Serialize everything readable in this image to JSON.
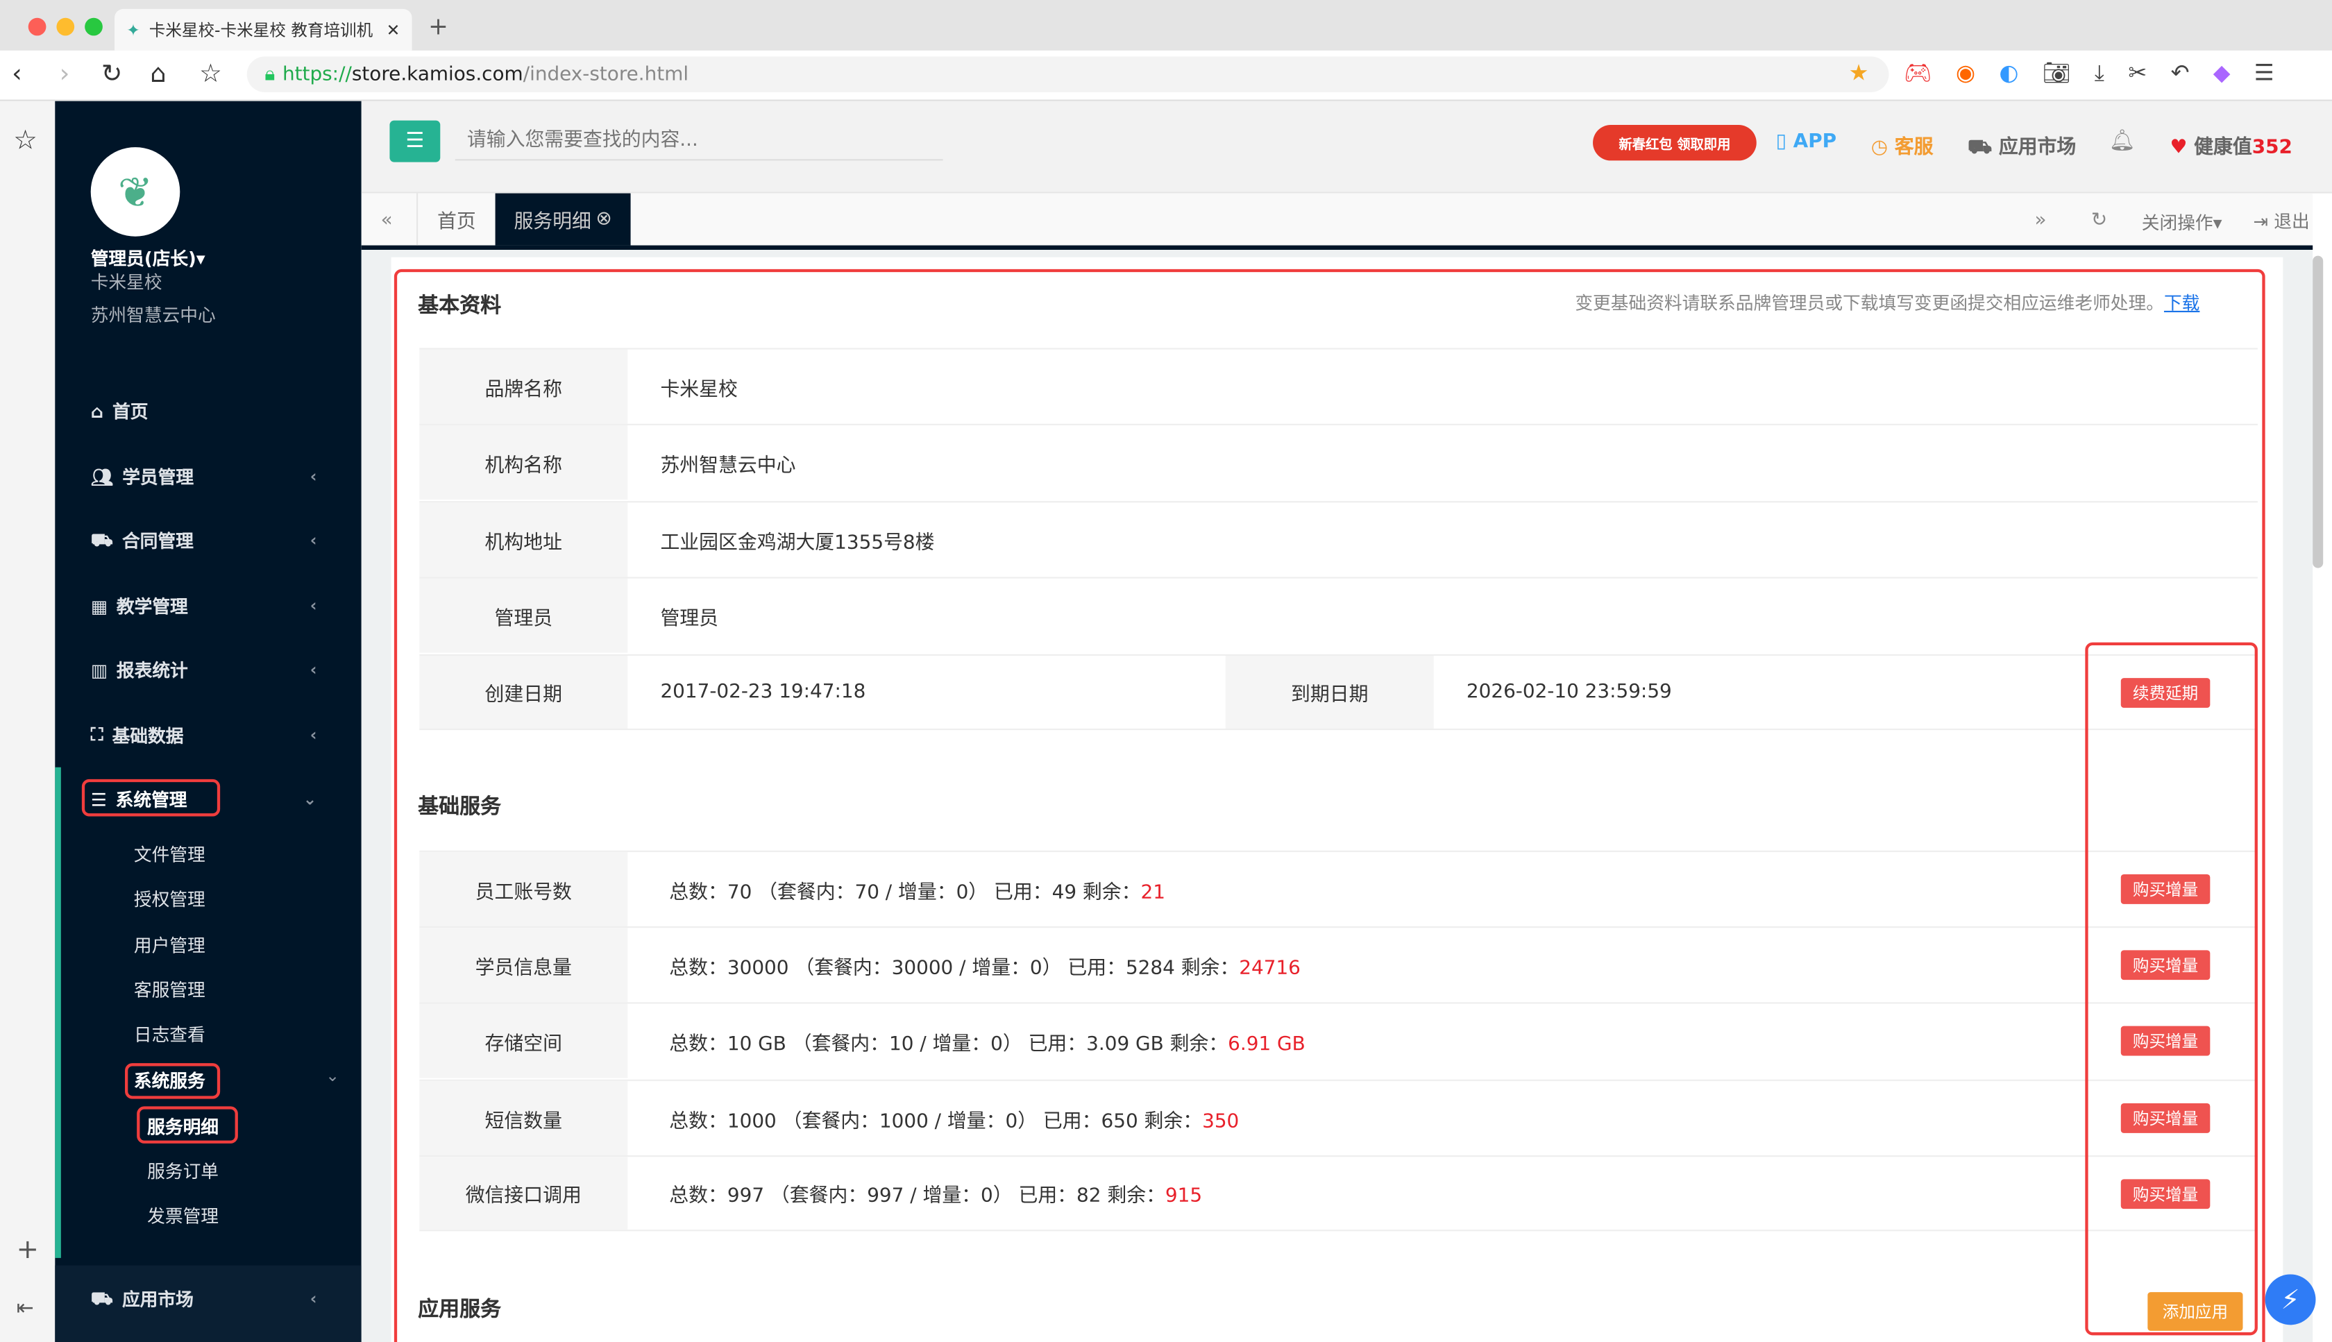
{
  "browser": {
    "tab_title": "卡米星校-卡米星校 教育培训机",
    "url_scheme": "https://",
    "url_host": "store.kamios.com",
    "url_path": "/index-store.html"
  },
  "user": {
    "name": "管理员(店长)▾",
    "brand": "卡米星校",
    "org": "苏州智慧云中心"
  },
  "sidebar": {
    "items": [
      {
        "label": "首页",
        "icon": "home-icon"
      },
      {
        "label": "学员管理",
        "icon": "users-icon"
      },
      {
        "label": "合同管理",
        "icon": "cart-icon"
      },
      {
        "label": "教学管理",
        "icon": "calendar-icon"
      },
      {
        "label": "报表统计",
        "icon": "bar-chart-icon"
      },
      {
        "label": "基础数据",
        "icon": "sitemap-icon"
      },
      {
        "label": "系统管理",
        "icon": "server-icon"
      }
    ],
    "sub": [
      "文件管理",
      "授权管理",
      "用户管理",
      "客服管理",
      "日志查看",
      "系统服务"
    ],
    "subsub": [
      "服务明细",
      "服务订单",
      "发票管理"
    ],
    "bottom": "应用市场"
  },
  "header": {
    "search_placeholder": "请输入您需要查找的内容...",
    "promo": "新春红包 领取即用",
    "app": "APP",
    "service": "客服",
    "market": "应用市场",
    "health_label": "健康值",
    "health_value": "352"
  },
  "tabs": {
    "home": "首页",
    "active": "服务明细",
    "close_ops": "关闭操作▾",
    "logout": "退出"
  },
  "basic": {
    "title": "基本资料",
    "notice": "变更基础资料请联系品牌管理员或下载填写变更函提交相应运维老师处理。",
    "download": "下载",
    "rows": [
      {
        "label": "品牌名称",
        "value": "卡米星校"
      },
      {
        "label": "机构名称",
        "value": "苏州智慧云中心"
      },
      {
        "label": "机构地址",
        "value": "工业园区金鸡湖大厦1355号8楼"
      },
      {
        "label": "管理员",
        "value": "管理员"
      }
    ],
    "created_label": "创建日期",
    "created": "2017-02-23 19:47:18",
    "expire_label": "到期日期",
    "expire": "2026-02-10 23:59:59",
    "renew": "续费延期"
  },
  "services": {
    "title": "基础服务",
    "buy": "购买增量",
    "rows": [
      {
        "label": "员工账号数",
        "text": "总数：70 （套餐内：70 / 增量：0） 已用：49 剩余：",
        "remain": "21"
      },
      {
        "label": "学员信息量",
        "text": "总数：30000 （套餐内：30000 / 增量：0） 已用：5284 剩余：",
        "remain": "24716"
      },
      {
        "label": "存储空间",
        "text": "总数：10 GB （套餐内：10 / 增量：0） 已用：3.09 GB 剩余：",
        "remain": "6.91 GB"
      },
      {
        "label": "短信数量",
        "text": "总数：1000 （套餐内：1000 / 增量：0） 已用：650 剩余：",
        "remain": "350"
      },
      {
        "label": "微信接口调用",
        "text": "总数：997 （套餐内：997 / 增量：0） 已用：82 剩余：",
        "remain": "915"
      }
    ]
  },
  "apps": {
    "title": "应用服务",
    "add": "添加应用"
  },
  "colors": {
    "sidebar": "#001528",
    "accent": "#26b393",
    "danger": "#ef5350",
    "annotation": "#f03d3d",
    "orange": "#f39c32"
  }
}
